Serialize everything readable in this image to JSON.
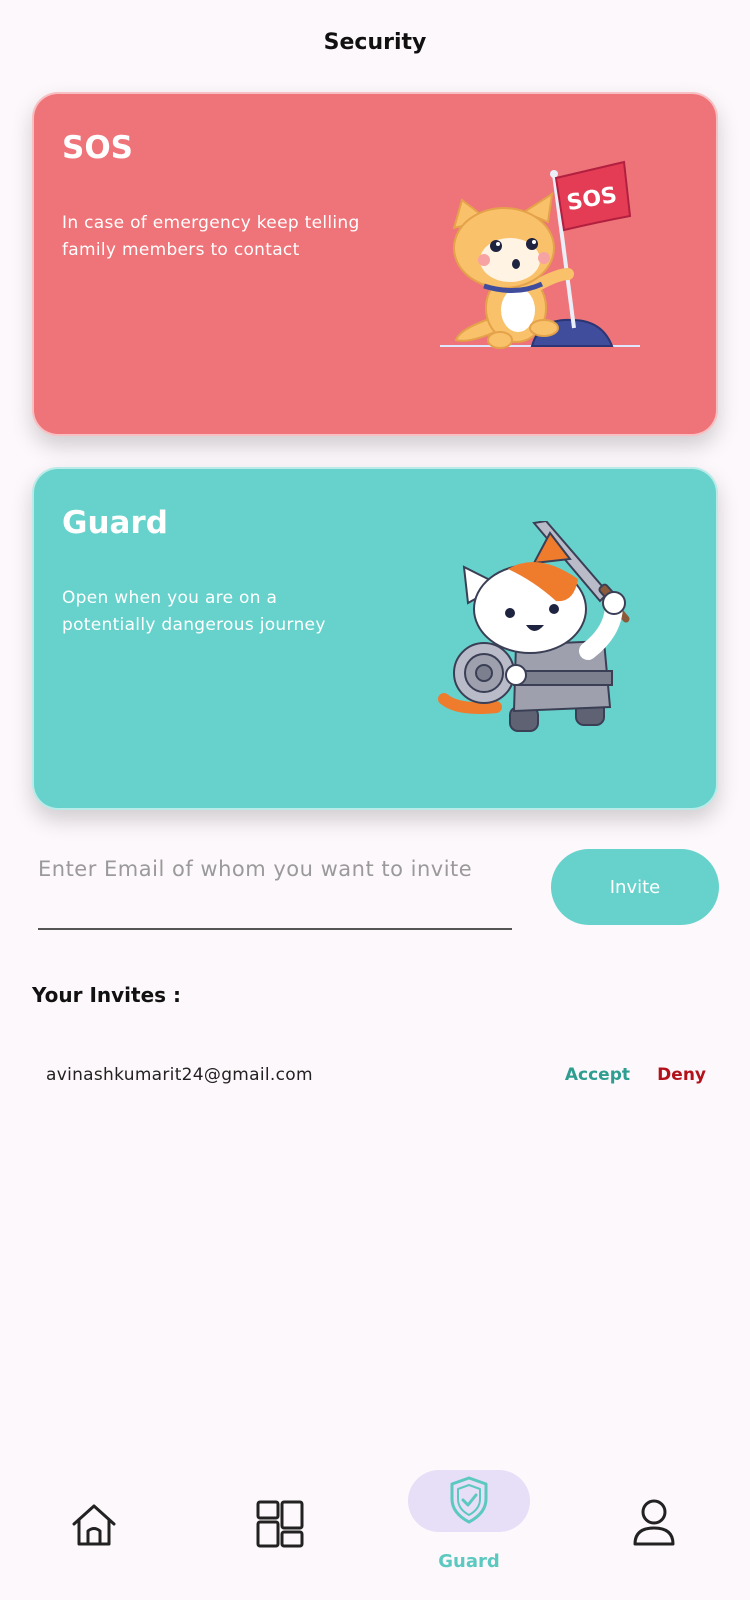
{
  "page": {
    "title": "Security"
  },
  "cards": {
    "sos": {
      "title": "SOS",
      "description": "In case of emergency keep telling family members to contact",
      "flag_text": "SOS",
      "color": "#ef7479"
    },
    "guard": {
      "title": "Guard",
      "description": "Open when you are on a potentially dangerous journey",
      "color": "#67d2cc"
    }
  },
  "invite_form": {
    "email_placeholder": "Enter Email of whom you want to invite",
    "email_value": "",
    "invite_label": "Invite"
  },
  "invites": {
    "heading": "Your Invites :",
    "items": [
      {
        "email": "avinashkumarit24@gmail.com",
        "accept_label": "Accept",
        "deny_label": "Deny"
      }
    ]
  },
  "bottom_nav": {
    "items": [
      {
        "icon": "home-icon",
        "label": ""
      },
      {
        "icon": "dashboard-icon",
        "label": ""
      },
      {
        "icon": "shield-check-icon",
        "label": "Guard",
        "active": true
      },
      {
        "icon": "user-icon",
        "label": ""
      }
    ],
    "active_color": "#5cc9c1",
    "pill_color": "#e7def7"
  }
}
